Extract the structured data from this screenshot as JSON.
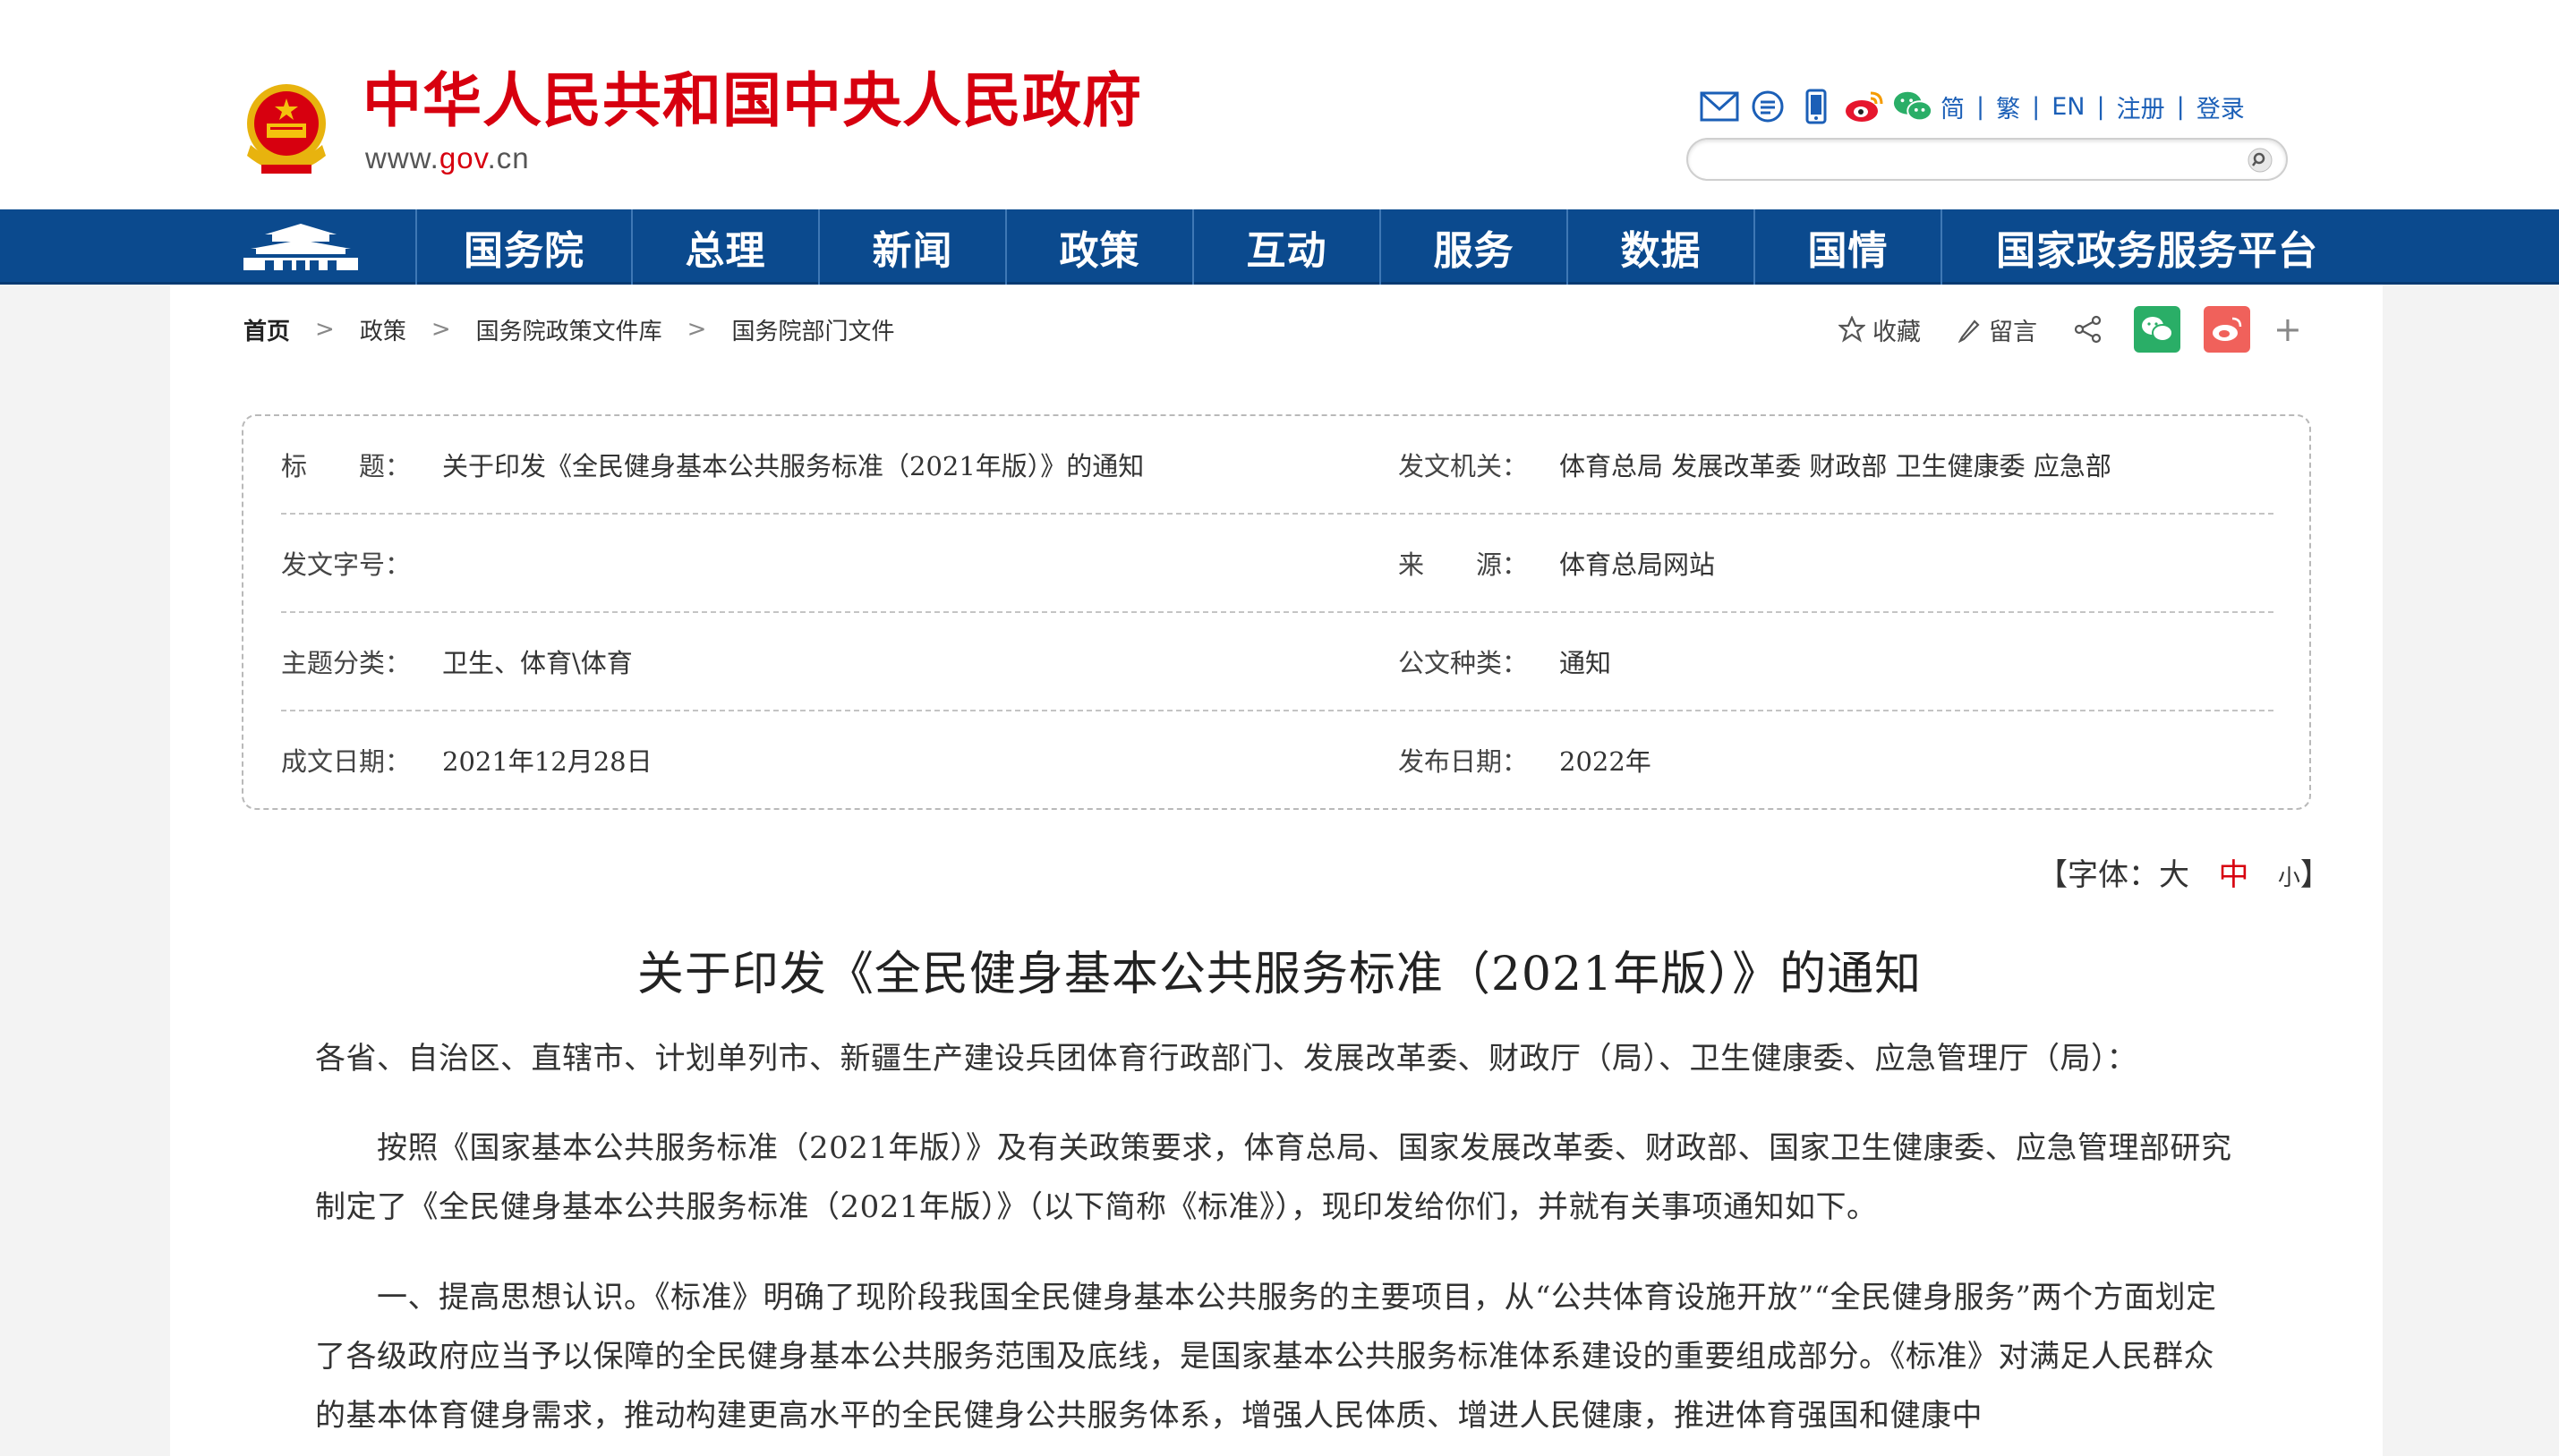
{
  "header": {
    "site_title": "中华人民共和国中央人民政府",
    "site_url_prefix": "www.",
    "site_url_brand": "gov",
    "site_url_suffix": ".cn",
    "lang_simplified": "简",
    "lang_traditional": "繁",
    "lang_english": "EN",
    "register": "注册",
    "login": "登录",
    "search_placeholder": "",
    "separator": "|"
  },
  "nav": {
    "items": [
      {
        "label": "国务院"
      },
      {
        "label": "总理"
      },
      {
        "label": "新闻"
      },
      {
        "label": "政策"
      },
      {
        "label": "互动"
      },
      {
        "label": "服务"
      },
      {
        "label": "数据"
      },
      {
        "label": "国情"
      },
      {
        "label": "国家政务服务平台"
      }
    ]
  },
  "breadcrumb": {
    "items": [
      "首页",
      "政策",
      "国务院政策文件库",
      "国务院部门文件"
    ],
    "separator": ">"
  },
  "share": {
    "favorite": "收藏",
    "comment": "留言",
    "more": "+"
  },
  "info": {
    "title_label": "标　　题：",
    "title_value": "关于印发《全民健身基本公共服务标准（2021年版）》的通知",
    "issuer_label": "发文机关：",
    "issuer_value": "体育总局 发展改革委 财政部 卫生健康委 应急部",
    "docno_label": "发文字号：",
    "docno_value": "",
    "source_label": "来　　源：",
    "source_value": "体育总局网站",
    "topic_label": "主题分类：",
    "topic_value": "卫生、体育\\体育",
    "doctype_label": "公文种类：",
    "doctype_value": "通知",
    "written_label": "成文日期：",
    "written_value": "2021年12月28日",
    "published_label": "发布日期：",
    "published_value": "2022年"
  },
  "fontsize": {
    "open": "【字体：",
    "large": "大",
    "medium": "中",
    "small": "小",
    "close": "】"
  },
  "article": {
    "title": "关于印发《全民健身基本公共服务标准（2021年版）》的通知",
    "addressee": "各省、自治区、直辖市、计划单列市、新疆生产建设兵团体育行政部门、发展改革委、财政厅（局）、卫生健康委、应急管理厅（局）：",
    "paragraph_1": "　　按照《国家基本公共服务标准（2021年版）》及有关政策要求，体育总局、国家发展改革委、财政部、国家卫生健康委、应急管理部研究制定了《全民健身基本公共服务标准（2021年版）》（以下简称《标准》），现印发给你们，并就有关事项通知如下。",
    "paragraph_2": "　　一、提高思想认识。《标准》明确了现阶段我国全民健身基本公共服务的主要项目，从“公共体育设施开放”“全民健身服务”两个方面划定了各级政府应当予以保障的全民健身基本公共服务范围及底线，是国家基本公共服务标准体系建设的重要组成部分。《标准》对满足人民群众的基本体育健身需求，推动构建更高水平的全民健身公共服务体系，增强人民体质、增进人民健康，推进体育强国和健康中"
  },
  "colors": {
    "brand_red": "#d7000f",
    "nav_blue": "#0b4a8e",
    "link_blue": "#1b5fb7"
  }
}
